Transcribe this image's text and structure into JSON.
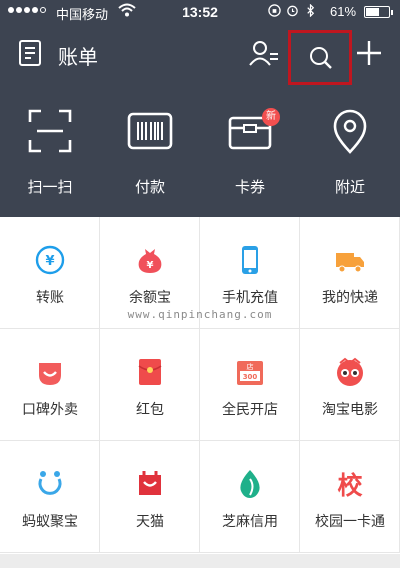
{
  "status_bar": {
    "carrier": "中国移动",
    "time": "13:52",
    "battery": "61%",
    "battery_level": 0.61
  },
  "header": {
    "title": "账单"
  },
  "quick_actions": [
    {
      "label": "扫一扫",
      "icon": "scan-icon"
    },
    {
      "label": "付款",
      "icon": "barcode-icon"
    },
    {
      "label": "卡券",
      "icon": "wallet-icon"
    },
    {
      "label": "附近",
      "icon": "location-icon"
    }
  ],
  "new_badge": "新",
  "services": [
    {
      "label": "转账",
      "icon": "transfer-icon",
      "color": "#1e9eea"
    },
    {
      "label": "余额宝",
      "icon": "yuebao-icon",
      "color": "#f0505a"
    },
    {
      "label": "手机充值",
      "icon": "phone-icon",
      "color": "#2aa0e6"
    },
    {
      "label": "我的快递",
      "icon": "truck-icon",
      "color": "#f7a13b"
    },
    {
      "label": "口碑外卖",
      "icon": "koubei-icon",
      "color": "#f25c5c"
    },
    {
      "label": "红包",
      "icon": "red-envelope-icon",
      "color": "#ef4b4b"
    },
    {
      "label": "全民开店",
      "icon": "shop-icon",
      "color": "#f06a5a"
    },
    {
      "label": "淘宝电影",
      "icon": "movie-icon",
      "color": "#f0504f"
    },
    {
      "label": "蚂蚁聚宝",
      "icon": "ant-icon",
      "color": "#3aa7e8"
    },
    {
      "label": "天猫",
      "icon": "tmall-icon",
      "color": "#e0323c"
    },
    {
      "label": "芝麻信用",
      "icon": "sesame-icon",
      "color": "#1fb08a"
    },
    {
      "label": "校园一卡通",
      "icon": "campus-icon",
      "color": "#ef4b4b",
      "glyph": "校"
    }
  ],
  "watermark": "www.qinpinchang.com"
}
